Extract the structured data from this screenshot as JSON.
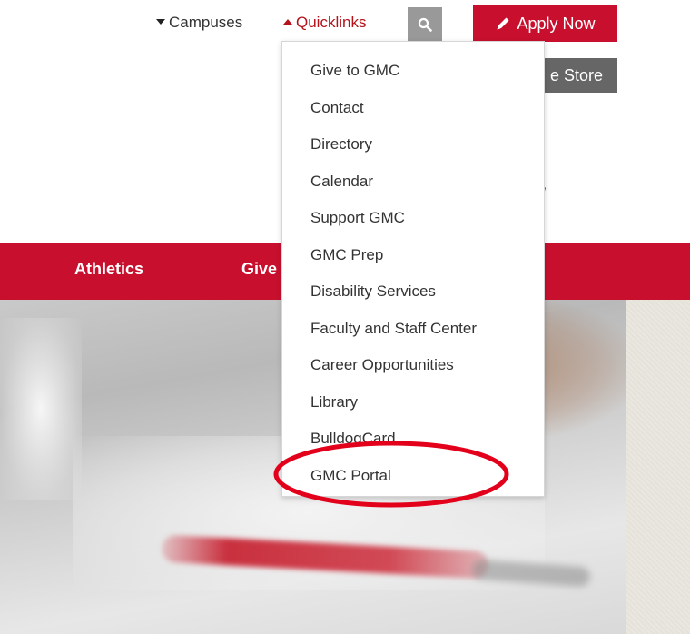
{
  "topnav": {
    "campuses_label": "Campuses",
    "quicklinks_label": "Quicklinks",
    "apply_label": "Apply Now",
    "store_label": "e Store"
  },
  "tagline": "where!",
  "mainnav": {
    "items": [
      {
        "label": "Athletics"
      },
      {
        "label": "Give"
      }
    ]
  },
  "quicklinks_menu": {
    "items": [
      {
        "label": "Give to GMC"
      },
      {
        "label": "Contact"
      },
      {
        "label": "Directory"
      },
      {
        "label": "Calendar"
      },
      {
        "label": "Support GMC"
      },
      {
        "label": "GMC Prep"
      },
      {
        "label": "Disability Services"
      },
      {
        "label": "Faculty and Staff Center"
      },
      {
        "label": "Career Opportunities"
      },
      {
        "label": "Library"
      },
      {
        "label": "BulldogCard"
      },
      {
        "label": "GMC Portal",
        "highlighted": true
      }
    ]
  },
  "icons": {
    "search": "search-icon",
    "apply": "pencil-icon",
    "campuses_caret": "caret-down-icon",
    "quicklinks_caret": "caret-up-icon"
  },
  "colors": {
    "brand_red": "#c8102e",
    "quicklinks_text": "#b5121b",
    "search_bg": "#999999",
    "store_bg": "#666666",
    "annotation": "#e3001b"
  }
}
